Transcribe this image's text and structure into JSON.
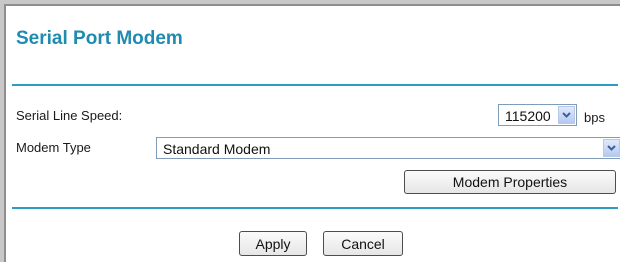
{
  "page": {
    "title": "Serial Port Modem"
  },
  "serial_line_speed": {
    "label": "Serial Line Speed:",
    "value": "115200",
    "unit": "bps"
  },
  "modem_type": {
    "label": "Modem Type",
    "value": "Standard Modem"
  },
  "buttons": {
    "modem_properties": "Modem Properties",
    "apply": "Apply",
    "cancel": "Cancel"
  },
  "icons": {
    "dropdown_arrow": "chevron-down-icon"
  },
  "colors": {
    "title": "#1f8bb0",
    "rule": "#2e9bc0"
  }
}
